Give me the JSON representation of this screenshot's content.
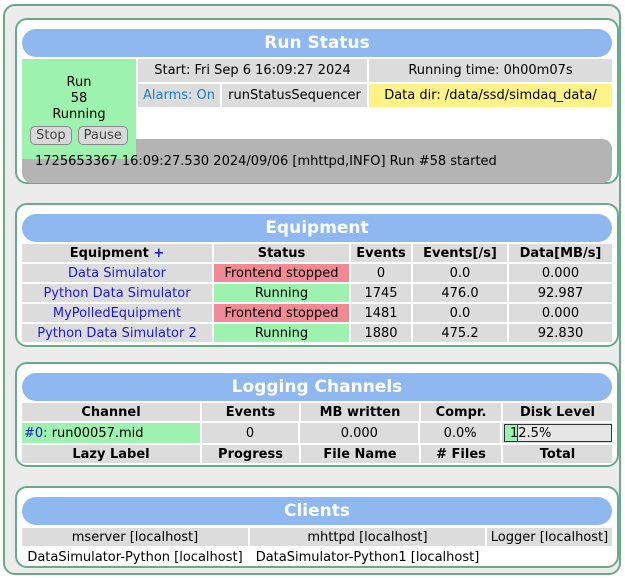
{
  "run_status": {
    "title": "Run Status",
    "run_label": "Run",
    "run_number": "58",
    "state": "Running",
    "stop_label": "Stop",
    "pause_label": "Pause",
    "start_time": "Start: Fri Sep 6 16:09:27 2024",
    "running_time": "Running time: 0h00m07s",
    "alarms": "Alarms: On",
    "sequencer": "runStatusSequencer",
    "data_dir": "Data dir: /data/ssd/simdaq_data/",
    "last_message": "1725653367 16:09:27.530 2024/09/06 [mhttpd,INFO] Run #58 started"
  },
  "equipment": {
    "title": "Equipment",
    "headers": {
      "name": "Equipment",
      "add": "+",
      "status": "Status",
      "events": "Events",
      "rate": "Events[/s]",
      "data": "Data[MB/s]"
    },
    "rows": [
      {
        "name": "Data Simulator",
        "status": "Frontend stopped",
        "events": "0",
        "rate": "0.0",
        "data": "0.000"
      },
      {
        "name": "Python Data Simulator",
        "status": "Running",
        "events": "1745",
        "rate": "476.0",
        "data": "92.987"
      },
      {
        "name": "MyPolledEquipment",
        "status": "Frontend stopped",
        "events": "1481",
        "rate": "0.0",
        "data": "0.000"
      },
      {
        "name": "Python Data Simulator 2",
        "status": "Running",
        "events": "1880",
        "rate": "475.2",
        "data": "92.830"
      }
    ]
  },
  "logging": {
    "title": "Logging Channels",
    "headers": {
      "channel": "Channel",
      "events": "Events",
      "mb": "MB written",
      "compr": "Compr.",
      "disk": "Disk Level"
    },
    "channel": {
      "name": "#0:",
      "file": "run00057.mid",
      "events": "0",
      "mb": "0.000",
      "compr": "0.0%",
      "disk": "12.5%",
      "disk_fraction": 0.125
    },
    "lazy_headers": {
      "label": "Lazy Label",
      "progress": "Progress",
      "file": "File Name",
      "files": "# Files",
      "total": "Total"
    }
  },
  "clients": {
    "title": "Clients",
    "row1": [
      "mserver [localhost]",
      "mhttpd [localhost]",
      "Logger [localhost]"
    ],
    "row2": [
      "DataSimulator-Python [localhost]",
      "DataSimulator-Python1 [localhost]"
    ]
  },
  "colors": {
    "title_bar": "#8eb8ef",
    "running": "#9ef2b0",
    "stopped": "#f28a96",
    "data_dir": "#fff388",
    "border": "#6aa98a"
  }
}
